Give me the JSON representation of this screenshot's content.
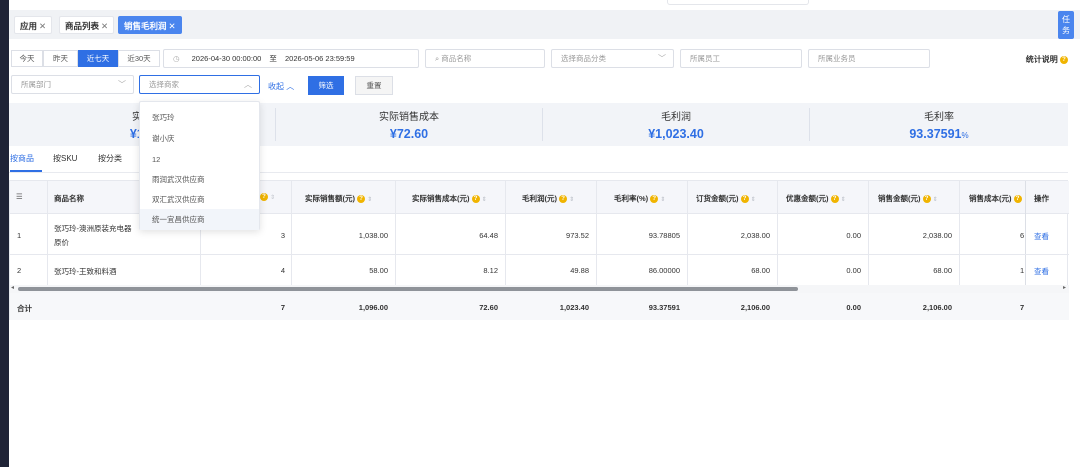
{
  "tabs": [
    {
      "label": "应用",
      "close": "✕",
      "active": false
    },
    {
      "label": "商品列表",
      "close": "✕",
      "active": false
    },
    {
      "label": "销售毛利润",
      "close": "✕",
      "active": true
    }
  ],
  "task_button": {
    "label_line1": "任",
    "label_line2": "务"
  },
  "quick_dates": [
    "今天",
    "昨天",
    "近七天",
    "近30天"
  ],
  "date_range": {
    "start": "2026-04-30 00:00:00",
    "separator": "至",
    "end": "2026-05-06 23:59:59"
  },
  "filters": {
    "product_name_placeholder": "商品名称",
    "category_placeholder": "选择商品分类",
    "employee_placeholder": "所属员工",
    "salesman_placeholder": "所属业务员",
    "department_placeholder": "所属部门",
    "merchant_placeholder": "选择商家"
  },
  "actions": {
    "collapse": "收起",
    "filter": "筛选",
    "reset": "重置"
  },
  "help_label": "统计说明",
  "summary": [
    {
      "label": "实际",
      "value": "¥1,0"
    },
    {
      "label": "实际销售成本",
      "value": "¥72.60"
    },
    {
      "label": "毛利润",
      "value": "¥1,023.40"
    },
    {
      "label": "毛利率",
      "value": "93.37591",
      "unit": "%"
    }
  ],
  "subtabs": [
    "按商品",
    "按SKU",
    "按分类"
  ],
  "table": {
    "headers": [
      "商品名称",
      "实际销售额(元)",
      "实际销售成本(元)",
      "毛利润(元)",
      "毛利率(%)",
      "订货金额(元)",
      "优惠金额(元)",
      "销售金额(元)",
      "销售成本(元)",
      "操作"
    ],
    "rows": [
      {
        "index": "1",
        "name_line1": "张巧玲-澳洲原装充电器",
        "name_line2": "原价",
        "qty": "3",
        "actual_sales": "1,038.00",
        "actual_cost": "64.48",
        "gross_profit": "973.52",
        "margin": "93.78805",
        "order_amount": "2,038.00",
        "discount": "0.00",
        "sales_amount": "2,038.00",
        "sales_cost": "6",
        "op": "查看"
      },
      {
        "index": "2",
        "name_line1": "张巧玲-王致和料酒",
        "name_line2": "",
        "qty": "4",
        "actual_sales": "58.00",
        "actual_cost": "8.12",
        "gross_profit": "49.88",
        "margin": "86.00000",
        "order_amount": "68.00",
        "discount": "0.00",
        "sales_amount": "68.00",
        "sales_cost": "1",
        "op": "查看"
      }
    ],
    "total": {
      "label": "合计",
      "qty": "7",
      "actual_sales": "1,096.00",
      "actual_cost": "72.60",
      "gross_profit": "1,023.40",
      "margin": "93.37591",
      "order_amount": "2,106.00",
      "discount": "0.00",
      "sales_amount": "2,106.00",
      "sales_cost": "7"
    }
  },
  "dropdown_options": [
    "张巧玲",
    "谢小庆",
    "12",
    "雨润武汉供应商",
    "双汇武汉供应商",
    "统一宜昌供应商"
  ],
  "colors": {
    "accent": "#2f6fe4",
    "tab_active": "#4a85ee",
    "warning": "#f0b400"
  }
}
